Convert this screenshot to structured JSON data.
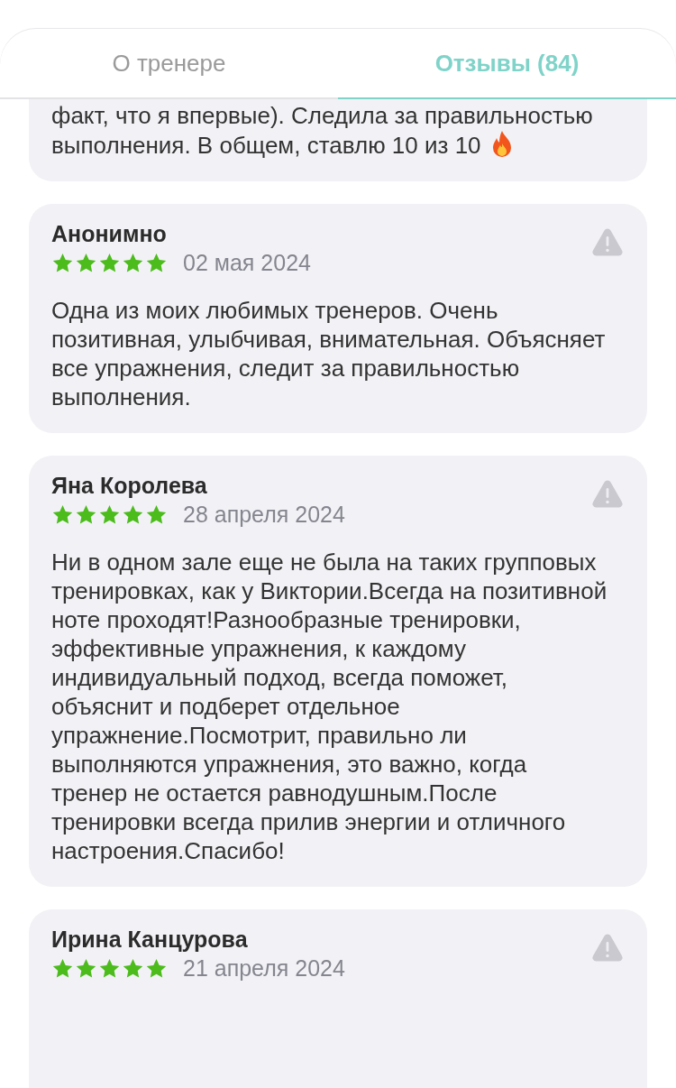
{
  "tabs": [
    {
      "label": "О тренере",
      "selected": false
    },
    {
      "label": "Отзывы (84)",
      "selected": true
    }
  ],
  "reviews": [
    {
      "kind": "cut",
      "text": "факт, что я впервые).  Следила за правильностью выполнения. В общем, ставлю 10 из 10",
      "flame": true
    },
    {
      "kind": "full",
      "author": "Анонимно",
      "stars": 5,
      "date": "02 мая 2024",
      "text": "Одна из моих любимых тренеров. Очень позитивная, улыбчивая, внимательная. Объясняет все упражнения, следит за правильностью выполнения.",
      "flame": false
    },
    {
      "kind": "full",
      "author": "Яна Королева",
      "stars": 5,
      "date": "28 апреля 2024",
      "text": "Ни в одном зале еще не была на таких групповых тренировках, как у Виктории.Всегда на позитивной ноте проходят!Разнообразные тренировки, эффективные упражнения, к каждому индивидуальный подход, всегда поможет, объяснит и подберет отдельное упражнение.Посмотрит, правильно ли выполняются упражнения, это важно, когда тренер не остается равнодушным.После тренировки всегда прилив энергии и отличного настроения.Спасибо!",
      "flame": false
    },
    {
      "kind": "full",
      "author": "Ирина Канцурова",
      "stars": 5,
      "date": "21 апреля 2024",
      "flame": false
    }
  ]
}
